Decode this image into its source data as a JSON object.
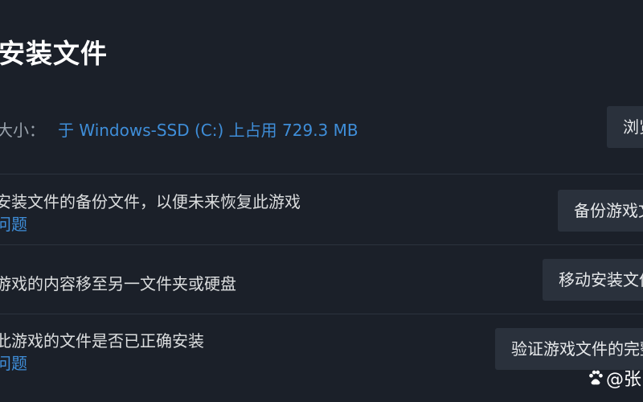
{
  "header": {
    "title": "安装文件"
  },
  "install_size": {
    "label": "大小：",
    "value": "于 Windows-SSD (C:) 上占用 729.3 MB",
    "browse_button": "浏览"
  },
  "backup": {
    "description": "安装文件的备份文件，以便未来恢复此游戏",
    "link": "问题",
    "button": "备份游戏文"
  },
  "move": {
    "description": "游戏的内容移至另一文件夹或硬盘",
    "button": "移动安装文件"
  },
  "verify": {
    "description": "此游戏的文件是否已正确安装",
    "link": "问题",
    "button": "验证游戏文件的完整"
  },
  "watermark": {
    "text": "@张",
    "icon": "paw-icon"
  }
}
